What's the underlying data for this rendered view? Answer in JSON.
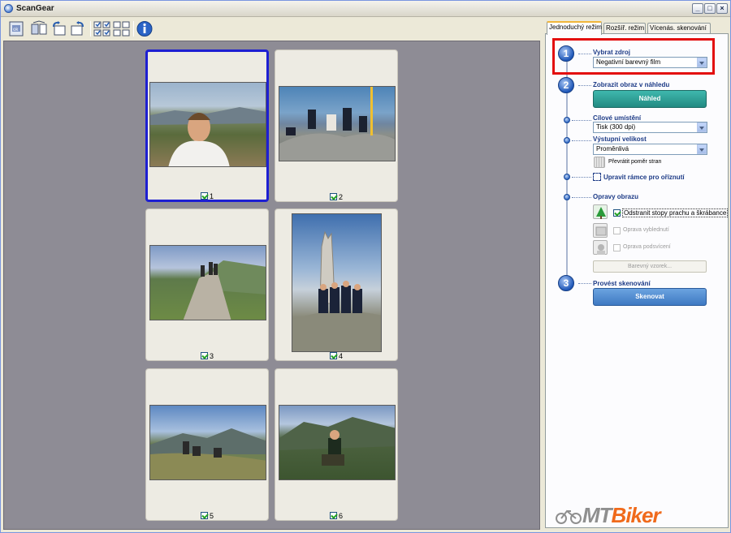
{
  "window": {
    "title": "ScanGear",
    "minimize": "_",
    "maximize": "□",
    "close": "×"
  },
  "toolbar": {
    "icons": [
      "scan-settings-icon",
      "mirror-icon",
      "rotate-left-icon",
      "rotate-right-icon",
      "select-all-icon",
      "thumbnail-view-icon",
      "info-icon"
    ]
  },
  "thumbnails": [
    {
      "number": "1",
      "selected": true
    },
    {
      "number": "2",
      "selected": false
    },
    {
      "number": "3",
      "selected": false
    },
    {
      "number": "4",
      "selected": false
    },
    {
      "number": "5",
      "selected": false
    },
    {
      "number": "6",
      "selected": false
    }
  ],
  "panel": {
    "tabs": [
      "Jednoduchý režim",
      "Rozšíř. režim",
      "Vícenás. skenování"
    ],
    "step1": {
      "number": "1",
      "label": "Vybrat zdroj",
      "select_value": "Negativní barevný film"
    },
    "step2": {
      "number": "2",
      "label": "Zobrazit obraz v náhledu",
      "button": "Náhled"
    },
    "destination": {
      "label": "Cílové umístění",
      "select_value": "Tisk (300 dpi)"
    },
    "output_size": {
      "label": "Výstupní velikost",
      "select_value": "Proměnlivá",
      "swap_label": "Převrátit poměr stran"
    },
    "crop": {
      "label": "Upravit rámce pro oříznutí"
    },
    "corrections": {
      "label": "Opravy obrazu",
      "dust": "Odstranit stopy prachu a škrábance",
      "fading": "Oprava vyblednutí",
      "backlight": "Oprava podsvícení",
      "color_pattern": "Barevný vzorek..."
    },
    "step3": {
      "number": "3",
      "label": "Provést skenování",
      "button": "Skenovat"
    }
  },
  "logo": {
    "prefix": "MT",
    "suffix": "Biker"
  },
  "colors": {
    "selection": "#1d1fd2",
    "highlight": "#e30d0d",
    "preview_button": "#2fa39a",
    "scan_button": "#4d87cc"
  }
}
